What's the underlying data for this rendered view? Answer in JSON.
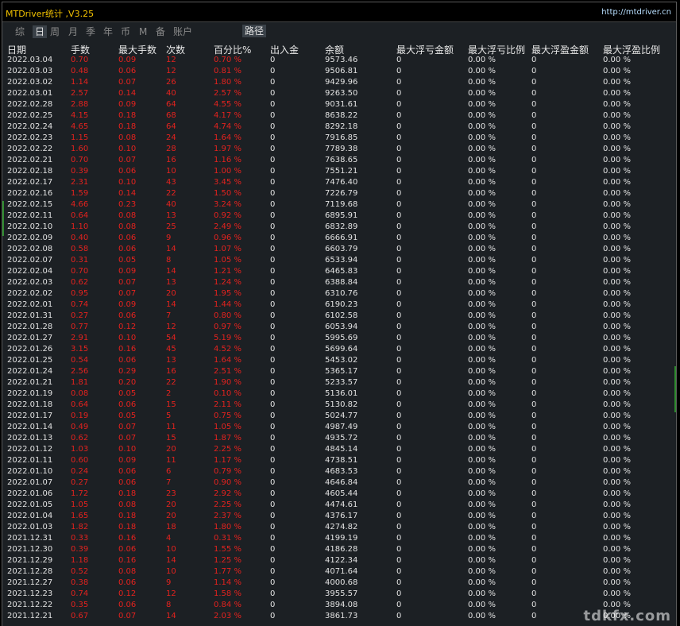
{
  "app": {
    "title": "MTDriver统计 ,V3.25",
    "url": "http://mtdriver.cn"
  },
  "tabs": [
    {
      "label": "综",
      "active": false
    },
    {
      "label": "日",
      "active": true
    },
    {
      "label": "周",
      "active": false
    },
    {
      "label": "月",
      "active": false
    },
    {
      "label": "季",
      "active": false
    },
    {
      "label": "年",
      "active": false
    },
    {
      "label": "币",
      "active": false
    },
    {
      "label": "M",
      "active": false
    },
    {
      "label": "备",
      "active": false
    },
    {
      "label": "账户",
      "active": false
    }
  ],
  "path_button": "路径",
  "columns": [
    "日期",
    "手数",
    "最大手数",
    "次数",
    "百分比%",
    "出入金",
    "余额",
    "最大浮亏金额",
    "最大浮亏比例",
    "最大浮盈金额",
    "最大浮盈比例"
  ],
  "rows": [
    [
      "2022.03.04",
      "0.70",
      "0.09",
      "12",
      "0.70 %",
      "0",
      "9573.46",
      "0",
      "0.00 %",
      "0",
      "0.00 %"
    ],
    [
      "2022.03.03",
      "0.48",
      "0.06",
      "12",
      "0.81 %",
      "0",
      "9506.81",
      "0",
      "0.00 %",
      "0",
      "0.00 %"
    ],
    [
      "2022.03.02",
      "1.14",
      "0.07",
      "26",
      "1.80 %",
      "0",
      "9429.96",
      "0",
      "0.00 %",
      "0",
      "0.00 %"
    ],
    [
      "2022.03.01",
      "2.57",
      "0.14",
      "40",
      "2.57 %",
      "0",
      "9263.50",
      "0",
      "0.00 %",
      "0",
      "0.00 %"
    ],
    [
      "2022.02.28",
      "2.88",
      "0.09",
      "64",
      "4.55 %",
      "0",
      "9031.61",
      "0",
      "0.00 %",
      "0",
      "0.00 %"
    ],
    [
      "2022.02.25",
      "4.15",
      "0.18",
      "68",
      "4.17 %",
      "0",
      "8638.22",
      "0",
      "0.00 %",
      "0",
      "0.00 %"
    ],
    [
      "2022.02.24",
      "4.65",
      "0.18",
      "64",
      "4.74 %",
      "0",
      "8292.18",
      "0",
      "0.00 %",
      "0",
      "0.00 %"
    ],
    [
      "2022.02.23",
      "1.15",
      "0.08",
      "24",
      "1.64 %",
      "0",
      "7916.85",
      "0",
      "0.00 %",
      "0",
      "0.00 %"
    ],
    [
      "2022.02.22",
      "1.60",
      "0.10",
      "28",
      "1.97 %",
      "0",
      "7789.38",
      "0",
      "0.00 %",
      "0",
      "0.00 %"
    ],
    [
      "2022.02.21",
      "0.70",
      "0.07",
      "16",
      "1.16 %",
      "0",
      "7638.65",
      "0",
      "0.00 %",
      "0",
      "0.00 %"
    ],
    [
      "2022.02.18",
      "0.39",
      "0.06",
      "10",
      "1.00 %",
      "0",
      "7551.21",
      "0",
      "0.00 %",
      "0",
      "0.00 %"
    ],
    [
      "2022.02.17",
      "2.31",
      "0.10",
      "43",
      "3.45 %",
      "0",
      "7476.40",
      "0",
      "0.00 %",
      "0",
      "0.00 %"
    ],
    [
      "2022.02.16",
      "1.59",
      "0.14",
      "22",
      "1.50 %",
      "0",
      "7226.79",
      "0",
      "0.00 %",
      "0",
      "0.00 %"
    ],
    [
      "2022.02.15",
      "4.66",
      "0.23",
      "40",
      "3.24 %",
      "0",
      "7119.68",
      "0",
      "0.00 %",
      "0",
      "0.00 %"
    ],
    [
      "2022.02.11",
      "0.64",
      "0.08",
      "13",
      "0.92 %",
      "0",
      "6895.91",
      "0",
      "0.00 %",
      "0",
      "0.00 %"
    ],
    [
      "2022.02.10",
      "1.10",
      "0.08",
      "25",
      "2.49 %",
      "0",
      "6832.89",
      "0",
      "0.00 %",
      "0",
      "0.00 %"
    ],
    [
      "2022.02.09",
      "0.40",
      "0.06",
      "9",
      "0.96 %",
      "0",
      "6666.91",
      "0",
      "0.00 %",
      "0",
      "0.00 %"
    ],
    [
      "2022.02.08",
      "0.58",
      "0.06",
      "14",
      "1.07 %",
      "0",
      "6603.79",
      "0",
      "0.00 %",
      "0",
      "0.00 %"
    ],
    [
      "2022.02.07",
      "0.31",
      "0.05",
      "8",
      "1.05 %",
      "0",
      "6533.94",
      "0",
      "0.00 %",
      "0",
      "0.00 %"
    ],
    [
      "2022.02.04",
      "0.70",
      "0.09",
      "14",
      "1.21 %",
      "0",
      "6465.83",
      "0",
      "0.00 %",
      "0",
      "0.00 %"
    ],
    [
      "2022.02.03",
      "0.62",
      "0.07",
      "13",
      "1.24 %",
      "0",
      "6388.84",
      "0",
      "0.00 %",
      "0",
      "0.00 %"
    ],
    [
      "2022.02.02",
      "0.95",
      "0.07",
      "20",
      "1.95 %",
      "0",
      "6310.76",
      "0",
      "0.00 %",
      "0",
      "0.00 %"
    ],
    [
      "2022.02.01",
      "0.74",
      "0.09",
      "14",
      "1.44 %",
      "0",
      "6190.23",
      "0",
      "0.00 %",
      "0",
      "0.00 %"
    ],
    [
      "2022.01.31",
      "0.27",
      "0.06",
      "7",
      "0.80 %",
      "0",
      "6102.58",
      "0",
      "0.00 %",
      "0",
      "0.00 %"
    ],
    [
      "2022.01.28",
      "0.77",
      "0.12",
      "12",
      "0.97 %",
      "0",
      "6053.94",
      "0",
      "0.00 %",
      "0",
      "0.00 %"
    ],
    [
      "2022.01.27",
      "2.91",
      "0.10",
      "54",
      "5.19 %",
      "0",
      "5995.69",
      "0",
      "0.00 %",
      "0",
      "0.00 %"
    ],
    [
      "2022.01.26",
      "3.15",
      "0.16",
      "45",
      "4.52 %",
      "0",
      "5699.64",
      "0",
      "0.00 %",
      "0",
      "0.00 %"
    ],
    [
      "2022.01.25",
      "0.54",
      "0.06",
      "13",
      "1.64 %",
      "0",
      "5453.02",
      "0",
      "0.00 %",
      "0",
      "0.00 %"
    ],
    [
      "2022.01.24",
      "2.56",
      "0.29",
      "16",
      "2.51 %",
      "0",
      "5365.17",
      "0",
      "0.00 %",
      "0",
      "0.00 %"
    ],
    [
      "2022.01.21",
      "1.81",
      "0.20",
      "22",
      "1.90 %",
      "0",
      "5233.57",
      "0",
      "0.00 %",
      "0",
      "0.00 %"
    ],
    [
      "2022.01.19",
      "0.08",
      "0.05",
      "2",
      "0.10 %",
      "0",
      "5136.01",
      "0",
      "0.00 %",
      "0",
      "0.00 %"
    ],
    [
      "2022.01.18",
      "0.64",
      "0.06",
      "15",
      "2.11 %",
      "0",
      "5130.82",
      "0",
      "0.00 %",
      "0",
      "0.00 %"
    ],
    [
      "2022.01.17",
      "0.19",
      "0.05",
      "5",
      "0.75 %",
      "0",
      "5024.77",
      "0",
      "0.00 %",
      "0",
      "0.00 %"
    ],
    [
      "2022.01.14",
      "0.49",
      "0.07",
      "11",
      "1.05 %",
      "0",
      "4987.49",
      "0",
      "0.00 %",
      "0",
      "0.00 %"
    ],
    [
      "2022.01.13",
      "0.62",
      "0.07",
      "15",
      "1.87 %",
      "0",
      "4935.72",
      "0",
      "0.00 %",
      "0",
      "0.00 %"
    ],
    [
      "2022.01.12",
      "1.03",
      "0.10",
      "20",
      "2.25 %",
      "0",
      "4845.14",
      "0",
      "0.00 %",
      "0",
      "0.00 %"
    ],
    [
      "2022.01.11",
      "0.60",
      "0.09",
      "11",
      "1.17 %",
      "0",
      "4738.51",
      "0",
      "0.00 %",
      "0",
      "0.00 %"
    ],
    [
      "2022.01.10",
      "0.24",
      "0.06",
      "6",
      "0.79 %",
      "0",
      "4683.53",
      "0",
      "0.00 %",
      "0",
      "0.00 %"
    ],
    [
      "2022.01.07",
      "0.27",
      "0.06",
      "7",
      "0.90 %",
      "0",
      "4646.84",
      "0",
      "0.00 %",
      "0",
      "0.00 %"
    ],
    [
      "2022.01.06",
      "1.72",
      "0.18",
      "23",
      "2.92 %",
      "0",
      "4605.44",
      "0",
      "0.00 %",
      "0",
      "0.00 %"
    ],
    [
      "2022.01.05",
      "1.05",
      "0.08",
      "20",
      "2.25 %",
      "0",
      "4474.61",
      "0",
      "0.00 %",
      "0",
      "0.00 %"
    ],
    [
      "2022.01.04",
      "1.65",
      "0.18",
      "20",
      "2.37 %",
      "0",
      "4376.17",
      "0",
      "0.00 %",
      "0",
      "0.00 %"
    ],
    [
      "2022.01.03",
      "1.82",
      "0.18",
      "18",
      "1.80 %",
      "0",
      "4274.82",
      "0",
      "0.00 %",
      "0",
      "0.00 %"
    ],
    [
      "2021.12.31",
      "0.33",
      "0.16",
      "4",
      "0.31 %",
      "0",
      "4199.19",
      "0",
      "0.00 %",
      "0",
      "0.00 %"
    ],
    [
      "2021.12.30",
      "0.39",
      "0.06",
      "10",
      "1.55 %",
      "0",
      "4186.28",
      "0",
      "0.00 %",
      "0",
      "0.00 %"
    ],
    [
      "2021.12.29",
      "1.18",
      "0.16",
      "14",
      "1.25 %",
      "0",
      "4122.34",
      "0",
      "0.00 %",
      "0",
      "0.00 %"
    ],
    [
      "2021.12.28",
      "0.52",
      "0.08",
      "10",
      "1.77 %",
      "0",
      "4071.64",
      "0",
      "0.00 %",
      "0",
      "0.00 %"
    ],
    [
      "2021.12.27",
      "0.38",
      "0.06",
      "9",
      "1.14 %",
      "0",
      "4000.68",
      "0",
      "0.00 %",
      "0",
      "0.00 %"
    ],
    [
      "2021.12.23",
      "0.74",
      "0.12",
      "12",
      "1.58 %",
      "0",
      "3955.57",
      "0",
      "0.00 %",
      "0",
      "0.00 %"
    ],
    [
      "2021.12.22",
      "0.35",
      "0.06",
      "8",
      "0.84 %",
      "0",
      "3894.08",
      "0",
      "0.00 %",
      "0",
      "0.00 %"
    ],
    [
      "2021.12.21",
      "0.67",
      "0.07",
      "14",
      "2.03 %",
      "0",
      "3861.73",
      "0",
      "0.00 %",
      "0",
      "0.00 %"
    ]
  ],
  "watermark": "tdkfx.com",
  "colors": {
    "title": "#f2c200",
    "url": "#b8dfff",
    "loss_values": "#e4221e",
    "neutral_values": "#e2e2e2",
    "background": "#1c2024"
  }
}
